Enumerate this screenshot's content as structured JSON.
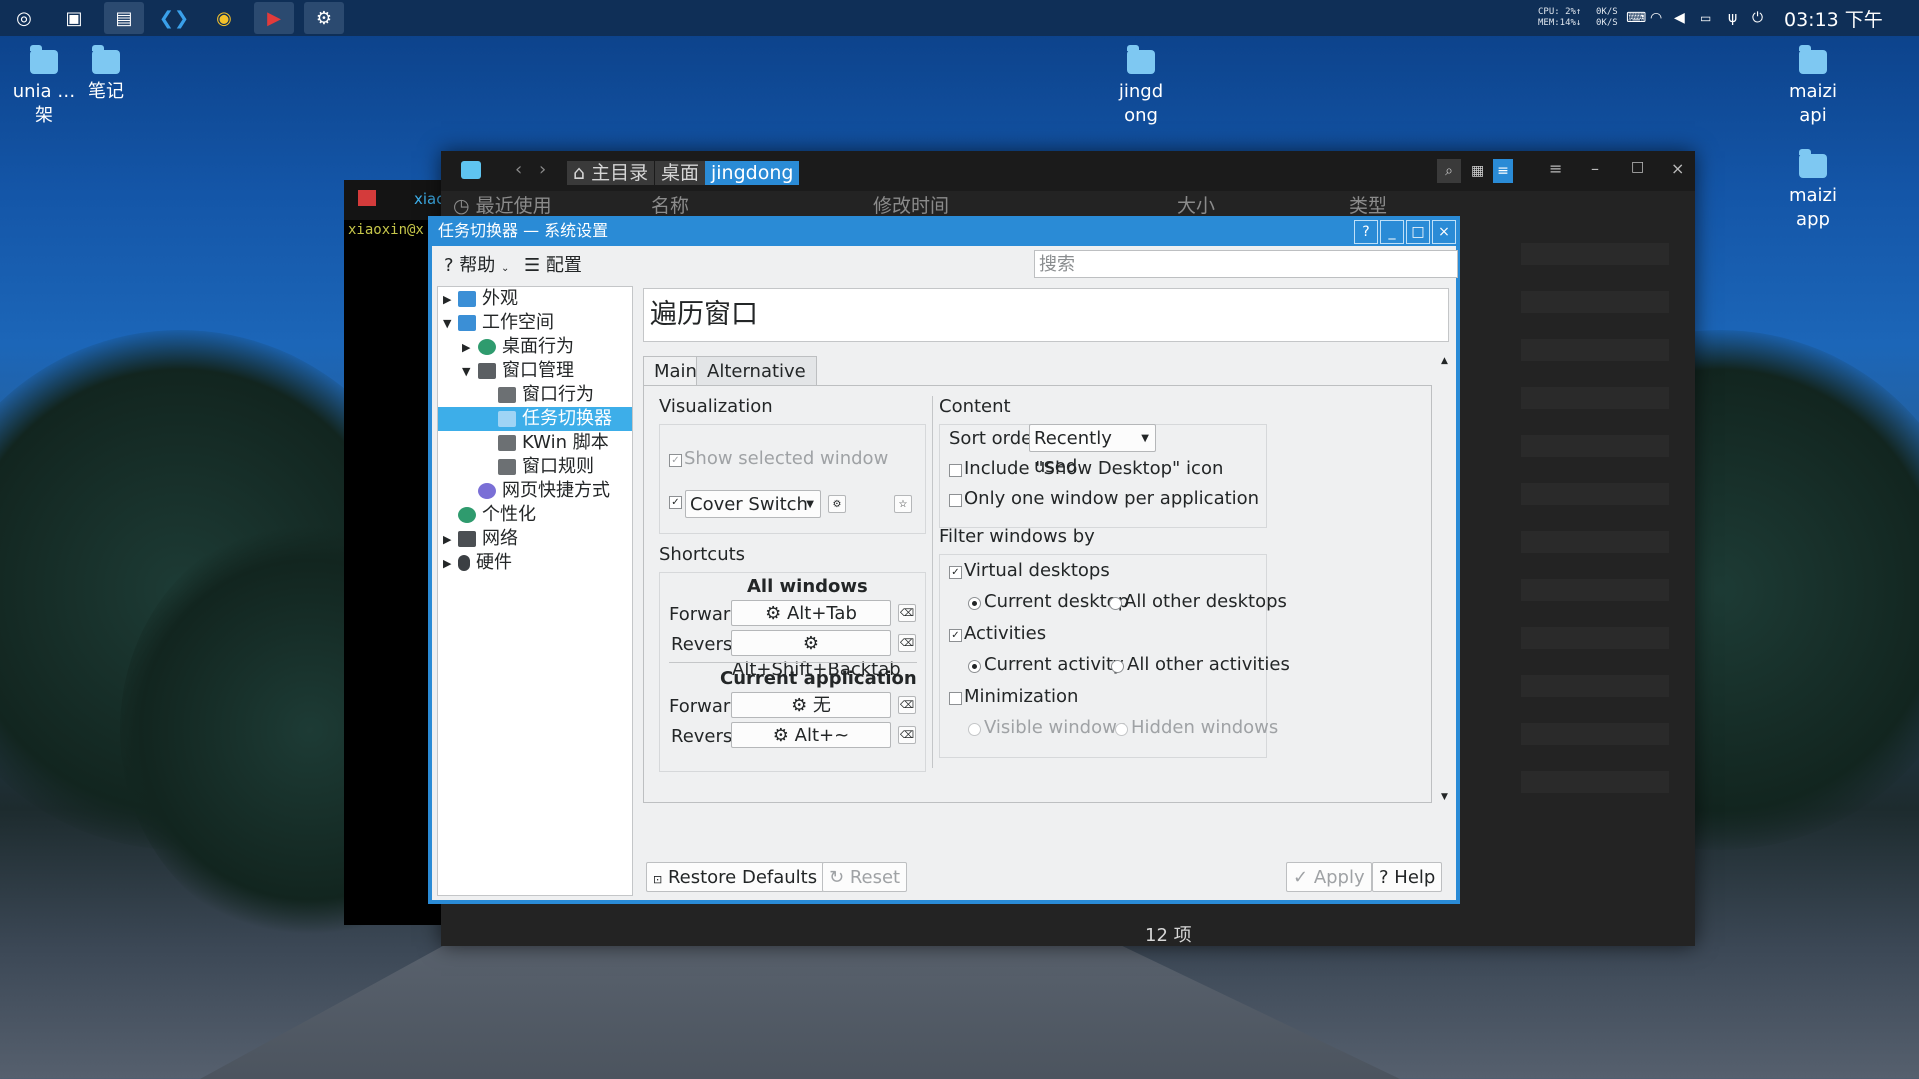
{
  "panel": {
    "cpu": "CPU: 2%↑",
    "mem": "MEM:14%↓",
    "net_up": "0K/S",
    "net_down": "0K/S",
    "clock": "03:13 下午"
  },
  "desktop": {
    "icons": [
      "unia …架",
      "笔记",
      "jingd ong",
      "maizi api",
      "maizi app"
    ]
  },
  "terminal": {
    "tab": "xiac",
    "prompt": "xiaoxin@x"
  },
  "file_manager": {
    "breadcrumb": [
      "主目录",
      "桌面",
      "jingdong"
    ],
    "sidebar_item": "最近使用",
    "columns": [
      "名称",
      "修改时间",
      "大小",
      "类型"
    ],
    "status": "12 项"
  },
  "dialog": {
    "title": "任务切换器 — 系统设置",
    "help_menu": "帮助",
    "config_menu": "配置",
    "search_placeholder": "搜索",
    "tree": {
      "appearance": "外观",
      "workspace": "工作空间",
      "desktop_behavior": "桌面行为",
      "window_management": "窗口管理",
      "window_behavior": "窗口行为",
      "task_switcher": "任务切换器",
      "kwin_scripts": "KWin 脚本",
      "window_rules": "窗口规则",
      "web_shortcuts": "网页快捷方式",
      "personalization": "个性化",
      "network": "网络",
      "hardware": "硬件"
    },
    "heading": "遍历窗口",
    "tabs": {
      "main": "Main",
      "alternative": "Alternative"
    },
    "visualization": {
      "label": "Visualization",
      "show_selected": "Show selected window",
      "effect": "Cover Switch"
    },
    "shortcuts": {
      "label": "Shortcuts",
      "all_windows": "All windows",
      "current_application": "Current application",
      "forward": "Forward",
      "reverse": "Reverse",
      "all_forward": "Alt+Tab",
      "all_reverse": "Alt+Shift+Backtab",
      "app_forward": "无",
      "app_reverse": "Alt+~"
    },
    "content": {
      "label": "Content",
      "sort_label": "Sort order:",
      "sort_value": "Recently used",
      "include_desktop": "Include \"Show Desktop\" icon",
      "one_per_app": "Only one window per application"
    },
    "filter": {
      "label": "Filter windows by",
      "virtual_desktops": "Virtual desktops",
      "current_desktop": "Current desktop",
      "other_desktops": "All other desktops",
      "activities": "Activities",
      "current_activity": "Current activity",
      "other_activities": "All other activities",
      "minimization": "Minimization",
      "visible_windows": "Visible windows",
      "hidden_windows": "Hidden windows"
    },
    "buttons": {
      "restore": "Restore Defaults",
      "reset": "Reset",
      "apply": "Apply",
      "help": "Help"
    }
  }
}
